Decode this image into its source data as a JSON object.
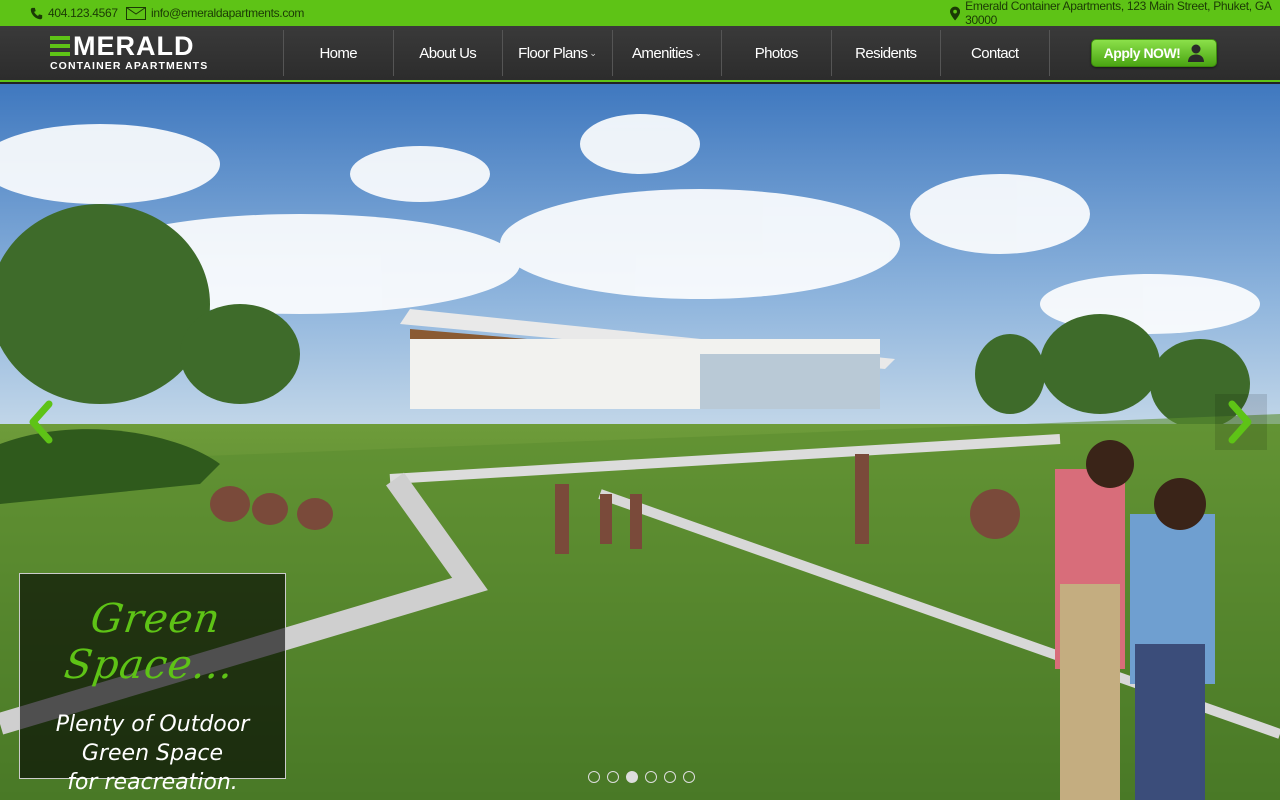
{
  "topbar": {
    "phone": "404.123.4567",
    "email": "info@emeraldapartments.com",
    "address": "Emerald Container Apartments, 123 Main Street, Phuket, GA 30000",
    "phone_icon": "phone-icon",
    "email_icon": "envelope-icon",
    "address_icon": "map-pin-icon"
  },
  "logo": {
    "word": "MERALD",
    "sub": "CONTAINER APARTMENTS"
  },
  "nav": {
    "items": [
      {
        "label": "Home",
        "dropdown": ""
      },
      {
        "label": "About Us",
        "dropdown": ""
      },
      {
        "label": "Floor Plans",
        "dropdown": "⌄"
      },
      {
        "label": "Amenities",
        "dropdown": "⌄"
      },
      {
        "label": "Photos",
        "dropdown": ""
      },
      {
        "label": "Residents",
        "dropdown": ""
      },
      {
        "label": "Contact",
        "dropdown": ""
      }
    ],
    "apply_label": "Apply NOW!",
    "apply_icon": "user-icon"
  },
  "hero": {
    "caption_title": "Green Space...",
    "caption_line1": "Plenty of Outdoor",
    "caption_line2": "Green Space",
    "caption_line3": "for reacreation.",
    "slides_total": 6,
    "active_slide": 3
  },
  "colors": {
    "accent": "#5ec316",
    "navbar": "#333333",
    "sky": "#4f86c6",
    "grass": "#4f8a2a"
  }
}
